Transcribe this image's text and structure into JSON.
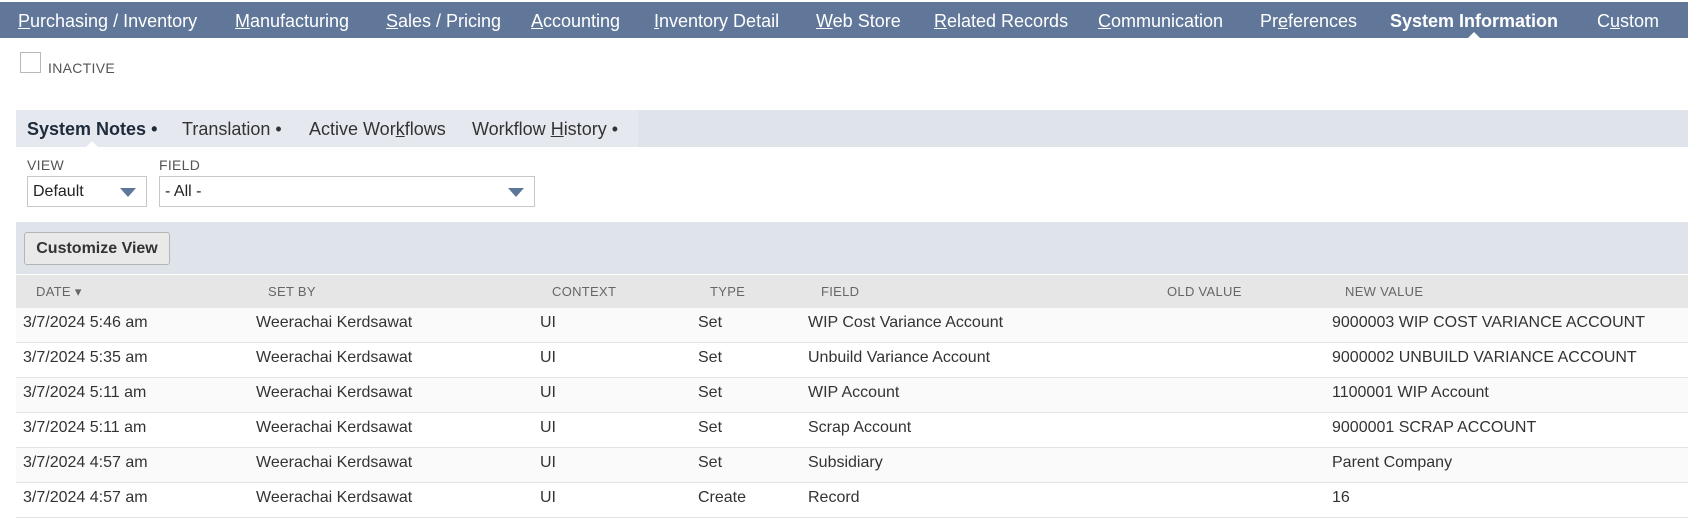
{
  "top_tabs": [
    {
      "pre": "",
      "ul": "P",
      "post": "urchasing / Inventory",
      "active": false
    },
    {
      "pre": "",
      "ul": "M",
      "post": "anufacturing",
      "active": false
    },
    {
      "pre": "",
      "ul": "S",
      "post": "ales / Pricing",
      "active": false
    },
    {
      "pre": "",
      "ul": "A",
      "post": "ccounting",
      "active": false
    },
    {
      "pre": "",
      "ul": "I",
      "post": "nventory Detail",
      "active": false
    },
    {
      "pre": "",
      "ul": "W",
      "post": "eb Store",
      "active": false
    },
    {
      "pre": "",
      "ul": "R",
      "post": "elated Records",
      "active": false
    },
    {
      "pre": "",
      "ul": "C",
      "post": "ommunication",
      "active": false
    },
    {
      "pre": "Pr",
      "ul": "e",
      "post": "ferences",
      "active": false
    },
    {
      "pre": "System Information",
      "ul": "",
      "post": "",
      "active": true
    },
    {
      "pre": "C",
      "ul": "u",
      "post": "stom",
      "active": false
    }
  ],
  "inactive_label": "INACTIVE",
  "sub_tabs": [
    {
      "pre": "System Notes",
      "ul": "",
      "post": "",
      "dot": " •",
      "active": true
    },
    {
      "pre": "Translation",
      "ul": "",
      "post": "",
      "dot": " •",
      "active": false
    },
    {
      "pre": "Active Wor",
      "ul": "k",
      "post": "flows",
      "dot": "",
      "active": false
    },
    {
      "pre": "Workflow ",
      "ul": "H",
      "post": "istory",
      "dot": " •",
      "active": false
    }
  ],
  "filters": {
    "view_label": "VIEW",
    "view_value": "Default",
    "field_label": "FIELD",
    "field_value": "- All -"
  },
  "customize_label": "Customize View",
  "columns": [
    "DATE ▾",
    "SET BY",
    "CONTEXT",
    "TYPE",
    "FIELD",
    "OLD VALUE",
    "NEW VALUE"
  ],
  "rows": [
    [
      "3/7/2024 5:46 am",
      "Weerachai Kerdsawat",
      "UI",
      "Set",
      "WIP Cost Variance Account",
      "",
      "9000003 WIP COST VARIANCE ACCOUNT"
    ],
    [
      "3/7/2024 5:35 am",
      "Weerachai Kerdsawat",
      "UI",
      "Set",
      "Unbuild Variance Account",
      "",
      "9000002 UNBUILD VARIANCE ACCOUNT"
    ],
    [
      "3/7/2024 5:11 am",
      "Weerachai Kerdsawat",
      "UI",
      "Set",
      "WIP Account",
      "",
      "1100001 WIP Account"
    ],
    [
      "3/7/2024 5:11 am",
      "Weerachai Kerdsawat",
      "UI",
      "Set",
      "Scrap Account",
      "",
      "9000001 SCRAP ACCOUNT"
    ],
    [
      "3/7/2024 4:57 am",
      "Weerachai Kerdsawat",
      "UI",
      "Set",
      "Subsidiary",
      "",
      "Parent Company"
    ],
    [
      "3/7/2024 4:57 am",
      "Weerachai Kerdsawat",
      "UI",
      "Create",
      "Record",
      "",
      "16"
    ]
  ]
}
